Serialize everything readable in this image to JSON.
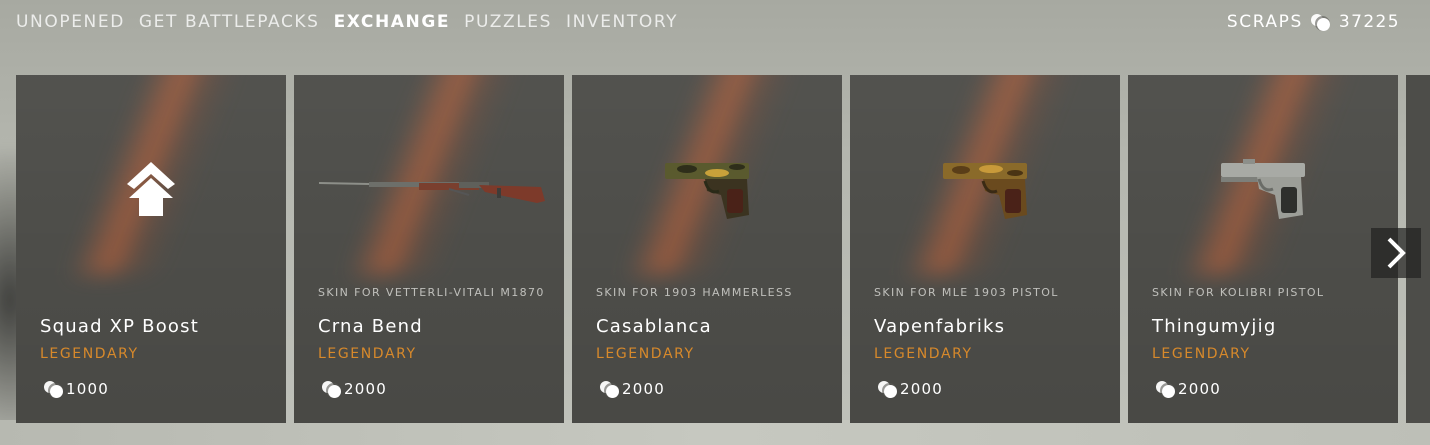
{
  "nav": {
    "tabs": [
      {
        "label": "UNOPENED",
        "active": false
      },
      {
        "label": "GET BATTLEPACKS",
        "active": false
      },
      {
        "label": "EXCHANGE",
        "active": true
      },
      {
        "label": "PUZZLES",
        "active": false
      },
      {
        "label": "INVENTORY",
        "active": false
      }
    ]
  },
  "currency": {
    "label": "SCRAPS",
    "icon": "scraps-icon",
    "amount": "37225"
  },
  "cards": [
    {
      "subtitle": "",
      "name": "Squad XP Boost",
      "rarity": "LEGENDARY",
      "price": "1000",
      "icon": "squad-xp-boost-icon"
    },
    {
      "subtitle": "SKIN FOR VETTERLI-VITALI M1870",
      "name": "Crna Bend",
      "rarity": "LEGENDARY",
      "price": "2000",
      "icon": "rifle-icon"
    },
    {
      "subtitle": "SKIN FOR 1903 HAMMERLESS",
      "name": "Casablanca",
      "rarity": "LEGENDARY",
      "price": "2000",
      "icon": "pistol-icon"
    },
    {
      "subtitle": "SKIN FOR MLE 1903 PISTOL",
      "name": "Vapenfabriks",
      "rarity": "LEGENDARY",
      "price": "2000",
      "icon": "pistol-icon"
    },
    {
      "subtitle": "SKIN FOR KOLIBRI PISTOL",
      "name": "Thingumyjig",
      "rarity": "LEGENDARY",
      "price": "2000",
      "icon": "pistol-icon"
    }
  ],
  "colors": {
    "rarity_legendary": "#d7892b",
    "card_background": "#4d4d49",
    "glow": "#d66637"
  },
  "next_button": {
    "icon": "chevron-right-icon"
  }
}
